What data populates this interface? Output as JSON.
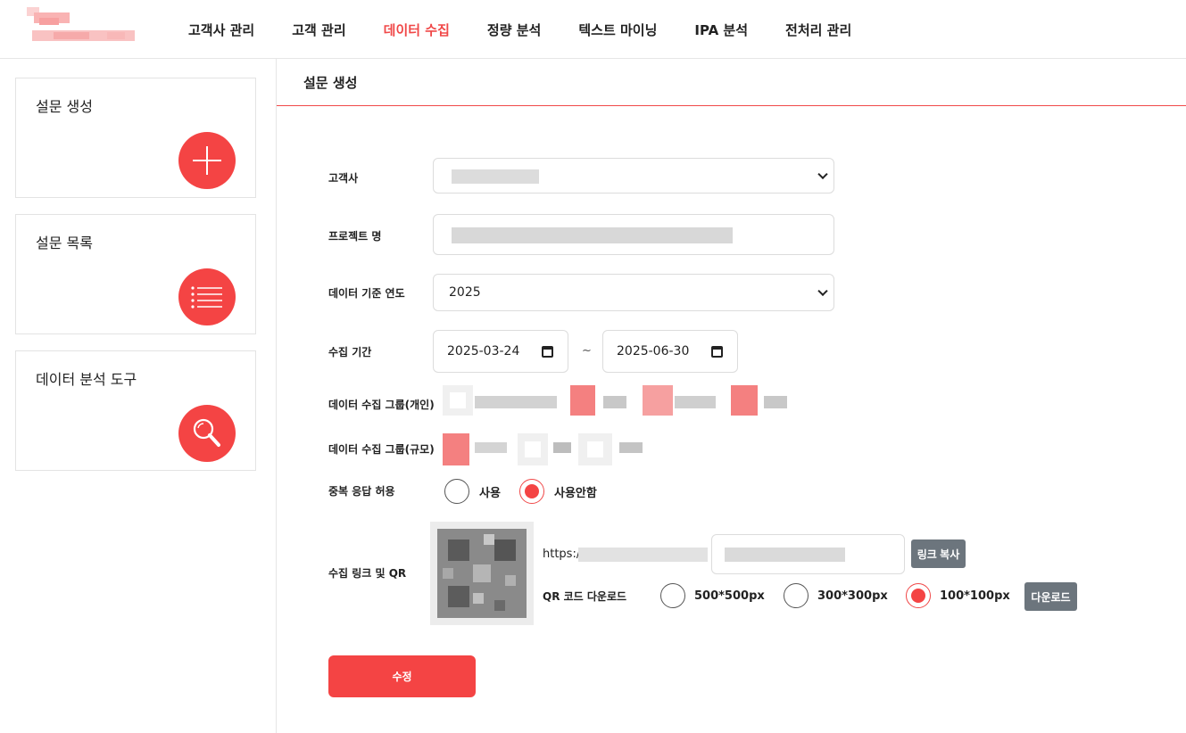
{
  "nav": {
    "items": [
      {
        "label": "고객사 관리"
      },
      {
        "label": "고객 관리"
      },
      {
        "label": "데이터 수집",
        "active": true
      },
      {
        "label": "정량 분석"
      },
      {
        "label": "텍스트 마이닝"
      },
      {
        "label": "IPA 분석"
      },
      {
        "label": "전처리 관리"
      }
    ]
  },
  "sidebar": {
    "cards": [
      {
        "title": "설문 생성",
        "icon": "plus-icon"
      },
      {
        "title": "설문 목록",
        "icon": "list-icon"
      },
      {
        "title": "데이터 분석 도구",
        "icon": "search-icon"
      }
    ]
  },
  "main": {
    "title": "설문 생성",
    "form": {
      "client_label": "고객사",
      "project_label": "프로젝트 명",
      "year_label": "데이터 기준 연도",
      "year_value": "2025",
      "period_label": "수집 기간",
      "start_date": "2025-03-24",
      "end_date": "2025-06-30",
      "tilde": "~",
      "group_individual_label": "데이터 수집 그룹(개인)",
      "group_scale_label": "데이터 수집 그룹(규모)",
      "duplicate_label": "중복 응답 허용",
      "duplicate_options": [
        {
          "label": "사용",
          "selected": false
        },
        {
          "label": "사용안함",
          "selected": true
        }
      ],
      "link_label": "수집 링크 및 QR",
      "link_prefix": "https:/",
      "copy_link_button": "링크 복사",
      "qr_download_label": "QR 코드 다운로드",
      "qr_sizes": [
        {
          "label": "500*500px",
          "selected": false
        },
        {
          "label": "300*300px",
          "selected": false
        },
        {
          "label": "100*100px",
          "selected": true
        }
      ],
      "download_button": "다운로드",
      "submit_button": "수정"
    }
  },
  "colors": {
    "accent": "#f44444",
    "accent_text": "#f04848",
    "gray_button": "#6c757d"
  }
}
